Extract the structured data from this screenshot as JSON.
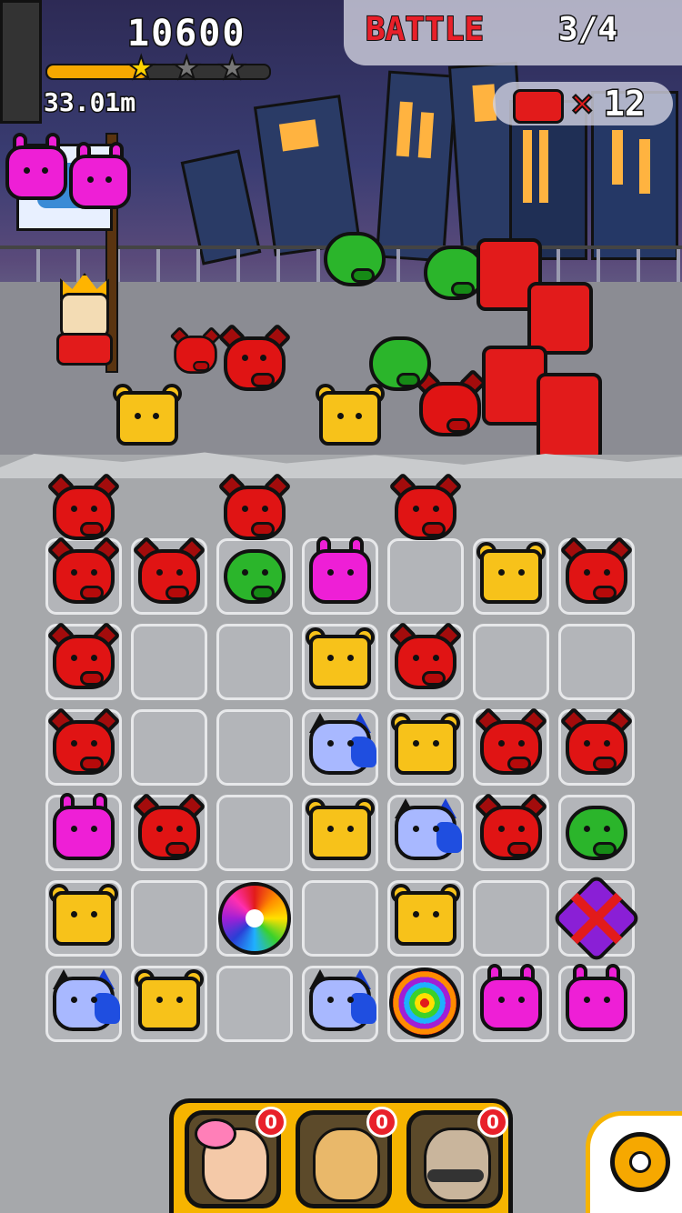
{
  "hud": {
    "score": "10600",
    "distance": "33.01m",
    "progress": 0.45,
    "stars_earned": 1,
    "stars_total": 3,
    "battle_label": "BATTLE",
    "battle_count": "3/4",
    "enemy_multiplier": "×",
    "enemy_count": "12"
  },
  "board": {
    "top_row": [
      "pig",
      "",
      "pig",
      "",
      "pig",
      "",
      ""
    ],
    "rows": [
      [
        "pig",
        "pig",
        "frog",
        "bunny",
        "empty",
        "bear",
        "pig"
      ],
      [
        "pig",
        "empty",
        "empty",
        "bear",
        "pig",
        "empty",
        "empty"
      ],
      [
        "pig",
        "empty",
        "empty",
        "cat",
        "bear",
        "pig",
        "pig"
      ],
      [
        "bunny",
        "pig",
        "empty",
        "bear",
        "cat",
        "pig",
        "frog"
      ],
      [
        "bear",
        "empty",
        "flower",
        "empty",
        "bear",
        "empty",
        "bomb"
      ],
      [
        "cat",
        "bear",
        "empty",
        "cat",
        "bullseye",
        "bunny",
        "bunny"
      ]
    ]
  },
  "characters": [
    {
      "name": "flower-girl",
      "badge": "0",
      "color": "#f4c9a8"
    },
    {
      "name": "grinning-warrior",
      "badge": "0",
      "color": "#e9b86a"
    },
    {
      "name": "mustache-boss",
      "badge": "0",
      "color": "#c9b59c"
    }
  ],
  "colors": {
    "accent": "#f6b400",
    "enemy": "#e21b1b",
    "pig": "#e01414",
    "bunny": "#ee1fd6",
    "bear": "#f7c21a",
    "cat": "#a8b8ff",
    "frog": "#2bb52b"
  },
  "icons": [
    "star-icon",
    "enemy-robot-icon",
    "settings-gear-icon",
    "flag-icon"
  ]
}
